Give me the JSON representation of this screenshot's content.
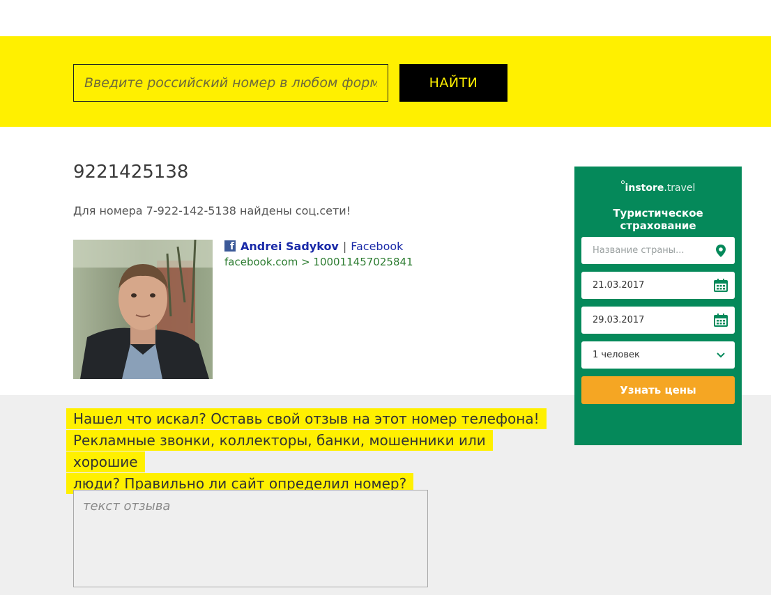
{
  "search": {
    "placeholder": "Введите российский номер в любом формате",
    "button_label": "НАЙТИ"
  },
  "result": {
    "phone_title": "9221425138",
    "found_text": "Для номера 7-922-142-5138 найдены соц.сети!",
    "profile": {
      "name": "Andrei Sadykov",
      "separator": "|",
      "network": "Facebook",
      "url": "facebook.com > 100011457025841",
      "icon": "facebook-icon"
    }
  },
  "review": {
    "prompt_lines": [
      "Нашел что искал? Оставь свой отзыв на этот номер телефона!",
      "Рекламные звонки, коллекторы, банки, мошенники или хорошие",
      "люди? Правильно ли сайт определил номер?"
    ],
    "placeholder": "текст отзыва"
  },
  "widget": {
    "logo_main": "instore",
    "logo_dot": ".",
    "logo_suffix": "travel",
    "title": "Туристическое страхование",
    "country_placeholder": "Название страны...",
    "date_from": "21.03.2017",
    "date_to": "29.03.2017",
    "persons": "1 человек",
    "button_label": "Узнать цены",
    "colors": {
      "background": "#05895a",
      "button": "#f5a623"
    }
  },
  "colors": {
    "accent_yellow": "#fff000",
    "band_gray": "#efefef"
  }
}
